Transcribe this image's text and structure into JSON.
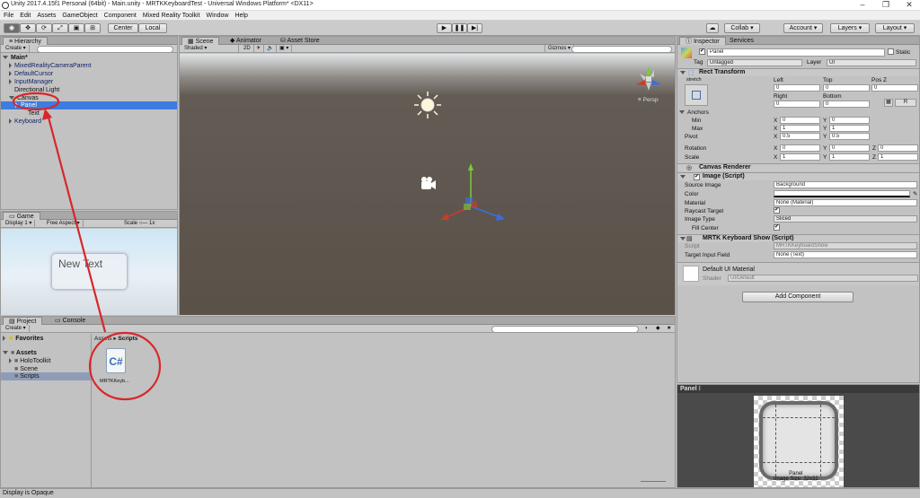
{
  "title": "Unity 2017.4.15f1 Personal (64bit) - Main.unity - MRTKKeyboardTest - Universal Windows Platform* <DX11>",
  "menu": [
    "File",
    "Edit",
    "Assets",
    "GameObject",
    "Component",
    "Mixed Reality Toolkit",
    "Window",
    "Help"
  ],
  "toolbar": {
    "center": "Center",
    "local": "Local",
    "collab": "Collab",
    "account": "Account",
    "layers": "Layers",
    "layout": "Layout"
  },
  "hierarchy": {
    "tab": "Hierarchy",
    "create": "Create",
    "scene": "Main*",
    "items": [
      "MixedRealityCameraParent",
      "DefaultCursor",
      "InputManager",
      "Directional Light",
      "Canvas",
      "Panel",
      "Text",
      "Keyboard"
    ]
  },
  "scene": {
    "tabs": [
      "Scene",
      "Animator",
      "Asset Store"
    ],
    "shaded": "Shaded",
    "mode_2d": "2D",
    "gizmos": "Gizmos",
    "persp": "Persp"
  },
  "game": {
    "tab": "Game",
    "display": "Display 1",
    "aspect": "Free Aspect",
    "scale_label": "Scale",
    "scale_value": "1x",
    "text": "New Text"
  },
  "project": {
    "tabs": [
      "Project",
      "Console"
    ],
    "create": "Create",
    "favorites": "Favorites",
    "assets": "Assets",
    "folders": [
      "HoloToolkit",
      "Scene",
      "Scripts"
    ],
    "breadcrumb_root": "Assets",
    "breadcrumb_current": "Scripts",
    "file_name": "MRTKKeyb..."
  },
  "inspector": {
    "tabs": [
      "Inspector",
      "Services"
    ],
    "name": "Panel",
    "static": "Static",
    "tag_label": "Tag",
    "tag": "Untagged",
    "layer_label": "Layer",
    "layer": "UI",
    "rect": {
      "title": "Rect Transform",
      "stretch": "stretch",
      "left_label": "Left",
      "top_label": "Top",
      "posz_label": "Pos Z",
      "left": "0",
      "top": "0",
      "posz": "0",
      "right_label": "Right",
      "bottom_label": "Bottom",
      "right": "0",
      "bottom": "0",
      "r_btn": "R",
      "anchors": "Anchors",
      "min": "Min",
      "max": "Max",
      "pivot": "Pivot",
      "min_x": "0",
      "min_y": "0",
      "max_x": "1",
      "max_y": "1",
      "pivot_x": "0.5",
      "pivot_y": "0.5",
      "rotation": "Rotation",
      "scale": "Scale",
      "rot_x": "0",
      "rot_y": "0",
      "rot_z": "0",
      "scale_x": "1",
      "scale_y": "1",
      "scale_z": "1"
    },
    "canvas_renderer": "Canvas Renderer",
    "image": {
      "title": "Image (Script)",
      "source_label": "Source Image",
      "source": "Background",
      "color_label": "Color",
      "material_label": "Material",
      "material": "None (Material)",
      "raycast_label": "Raycast Target",
      "type_label": "Image Type",
      "type": "Sliced",
      "fill_label": "Fill Center"
    },
    "mrtk": {
      "title": "MRTK Keyboard Show (Script)",
      "script_label": "Script",
      "script": "MRTKKeyboardShow",
      "target_label": "Target Input Field",
      "target": "None (Text)"
    },
    "material": {
      "name": "Default UI Material",
      "shader_label": "Shader",
      "shader": "UI/Default"
    },
    "add_component": "Add Component",
    "preview_tab": "Panel",
    "preview_caption": "Panel\nImage Size: 32x32"
  },
  "status": "Display is Opaque",
  "colors": {
    "annotation": "#d9262a",
    "selection": "#3e7ce0"
  }
}
